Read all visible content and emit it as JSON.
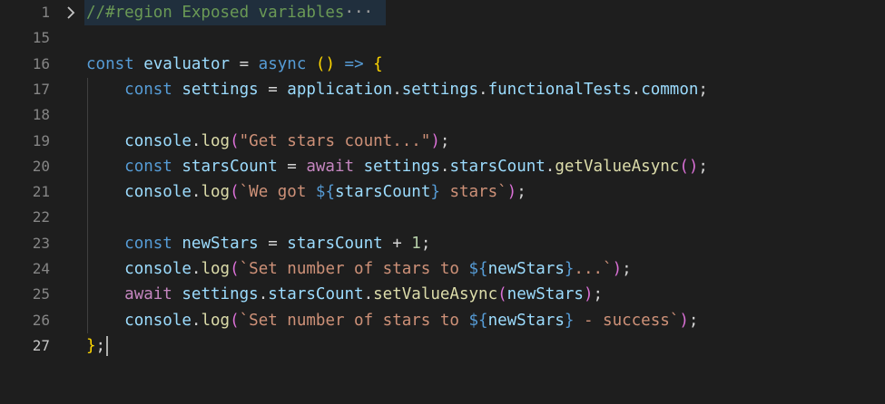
{
  "editor": {
    "language": "javascript",
    "theme": "dark",
    "active_line": "27"
  },
  "lines": [
    {
      "number": "1",
      "folded": true,
      "tokens": [
        {
          "t": "//#region Exposed variables",
          "c": "cmt"
        },
        {
          "t": "···",
          "c": "ellipsis"
        }
      ]
    },
    {
      "number": "15",
      "tokens": []
    },
    {
      "number": "16",
      "tokens": [
        {
          "t": "const",
          "c": "kw"
        },
        {
          "t": " ",
          "c": "op"
        },
        {
          "t": "evaluator",
          "c": "var"
        },
        {
          "t": " = ",
          "c": "op"
        },
        {
          "t": "async",
          "c": "kw"
        },
        {
          "t": " ",
          "c": "op"
        },
        {
          "t": "()",
          "c": "p1"
        },
        {
          "t": " ",
          "c": "op"
        },
        {
          "t": "=>",
          "c": "kw"
        },
        {
          "t": " ",
          "c": "op"
        },
        {
          "t": "{",
          "c": "p1"
        }
      ]
    },
    {
      "number": "17",
      "tokens": [
        {
          "t": "    ",
          "c": "op"
        },
        {
          "t": "const",
          "c": "kw"
        },
        {
          "t": " ",
          "c": "op"
        },
        {
          "t": "settings",
          "c": "var"
        },
        {
          "t": " = ",
          "c": "op"
        },
        {
          "t": "application",
          "c": "var"
        },
        {
          "t": ".",
          "c": "op"
        },
        {
          "t": "settings",
          "c": "var"
        },
        {
          "t": ".",
          "c": "op"
        },
        {
          "t": "functionalTests",
          "c": "var"
        },
        {
          "t": ".",
          "c": "op"
        },
        {
          "t": "common",
          "c": "var"
        },
        {
          "t": ";",
          "c": "op"
        }
      ]
    },
    {
      "number": "18",
      "tokens": []
    },
    {
      "number": "19",
      "tokens": [
        {
          "t": "    ",
          "c": "op"
        },
        {
          "t": "console",
          "c": "var"
        },
        {
          "t": ".",
          "c": "op"
        },
        {
          "t": "log",
          "c": "fn"
        },
        {
          "t": "(",
          "c": "p2"
        },
        {
          "t": "\"Get stars count...\"",
          "c": "str"
        },
        {
          "t": ")",
          "c": "p2"
        },
        {
          "t": ";",
          "c": "op"
        }
      ]
    },
    {
      "number": "20",
      "tokens": [
        {
          "t": "    ",
          "c": "op"
        },
        {
          "t": "const",
          "c": "kw"
        },
        {
          "t": " ",
          "c": "op"
        },
        {
          "t": "starsCount",
          "c": "var"
        },
        {
          "t": " = ",
          "c": "op"
        },
        {
          "t": "await",
          "c": "ctrl"
        },
        {
          "t": " ",
          "c": "op"
        },
        {
          "t": "settings",
          "c": "var"
        },
        {
          "t": ".",
          "c": "op"
        },
        {
          "t": "starsCount",
          "c": "var"
        },
        {
          "t": ".",
          "c": "op"
        },
        {
          "t": "getValueAsync",
          "c": "fn"
        },
        {
          "t": "()",
          "c": "p2"
        },
        {
          "t": ";",
          "c": "op"
        }
      ]
    },
    {
      "number": "21",
      "tokens": [
        {
          "t": "    ",
          "c": "op"
        },
        {
          "t": "console",
          "c": "var"
        },
        {
          "t": ".",
          "c": "op"
        },
        {
          "t": "log",
          "c": "fn"
        },
        {
          "t": "(",
          "c": "p2"
        },
        {
          "t": "`We got ",
          "c": "str"
        },
        {
          "t": "${",
          "c": "interp"
        },
        {
          "t": "starsCount",
          "c": "var"
        },
        {
          "t": "}",
          "c": "interp"
        },
        {
          "t": " stars`",
          "c": "str"
        },
        {
          "t": ")",
          "c": "p2"
        },
        {
          "t": ";",
          "c": "op"
        }
      ]
    },
    {
      "number": "22",
      "tokens": []
    },
    {
      "number": "23",
      "tokens": [
        {
          "t": "    ",
          "c": "op"
        },
        {
          "t": "const",
          "c": "kw"
        },
        {
          "t": " ",
          "c": "op"
        },
        {
          "t": "newStars",
          "c": "var"
        },
        {
          "t": " = ",
          "c": "op"
        },
        {
          "t": "starsCount",
          "c": "var"
        },
        {
          "t": " + ",
          "c": "op"
        },
        {
          "t": "1",
          "c": "num"
        },
        {
          "t": ";",
          "c": "op"
        }
      ]
    },
    {
      "number": "24",
      "tokens": [
        {
          "t": "    ",
          "c": "op"
        },
        {
          "t": "console",
          "c": "var"
        },
        {
          "t": ".",
          "c": "op"
        },
        {
          "t": "log",
          "c": "fn"
        },
        {
          "t": "(",
          "c": "p2"
        },
        {
          "t": "`Set number of stars to ",
          "c": "str"
        },
        {
          "t": "${",
          "c": "interp"
        },
        {
          "t": "newStars",
          "c": "var"
        },
        {
          "t": "}",
          "c": "interp"
        },
        {
          "t": "...`",
          "c": "str"
        },
        {
          "t": ")",
          "c": "p2"
        },
        {
          "t": ";",
          "c": "op"
        }
      ]
    },
    {
      "number": "25",
      "tokens": [
        {
          "t": "    ",
          "c": "op"
        },
        {
          "t": "await",
          "c": "ctrl"
        },
        {
          "t": " ",
          "c": "op"
        },
        {
          "t": "settings",
          "c": "var"
        },
        {
          "t": ".",
          "c": "op"
        },
        {
          "t": "starsCount",
          "c": "var"
        },
        {
          "t": ".",
          "c": "op"
        },
        {
          "t": "setValueAsync",
          "c": "fn"
        },
        {
          "t": "(",
          "c": "p2"
        },
        {
          "t": "newStars",
          "c": "var"
        },
        {
          "t": ")",
          "c": "p2"
        },
        {
          "t": ";",
          "c": "op"
        }
      ]
    },
    {
      "number": "26",
      "tokens": [
        {
          "t": "    ",
          "c": "op"
        },
        {
          "t": "console",
          "c": "var"
        },
        {
          "t": ".",
          "c": "op"
        },
        {
          "t": "log",
          "c": "fn"
        },
        {
          "t": "(",
          "c": "p2"
        },
        {
          "t": "`Set number of stars to ",
          "c": "str"
        },
        {
          "t": "${",
          "c": "interp"
        },
        {
          "t": "newStars",
          "c": "var"
        },
        {
          "t": "}",
          "c": "interp"
        },
        {
          "t": " - success`",
          "c": "str"
        },
        {
          "t": ")",
          "c": "p2"
        },
        {
          "t": ";",
          "c": "op"
        }
      ]
    },
    {
      "number": "27",
      "tokens": [
        {
          "t": "}",
          "c": "p1"
        },
        {
          "t": ";",
          "c": "op"
        }
      ],
      "cursor": true
    }
  ]
}
